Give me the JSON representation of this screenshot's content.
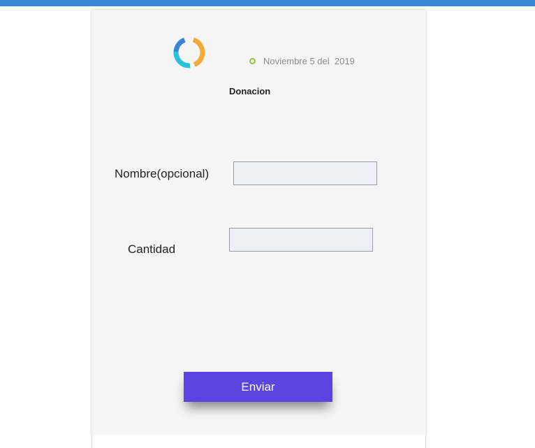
{
  "header": {
    "date": "Noviembre 5 del  2019",
    "title": "Donacion",
    "colors": {
      "topbar": "#3a86d6",
      "date_dot": "#8cc43f",
      "logo": [
        "#3a86d6",
        "#f4a93b",
        "#27c2dc"
      ]
    }
  },
  "form": {
    "name_label": "Nombre(opcional)",
    "name_value": "",
    "amount_label": "Cantidad",
    "amount_value": "",
    "submit_label": "Enviar",
    "accent": "#5b44e0"
  },
  "icons": {
    "logo": "circular-logo-icon",
    "date": "status-dot-icon"
  }
}
